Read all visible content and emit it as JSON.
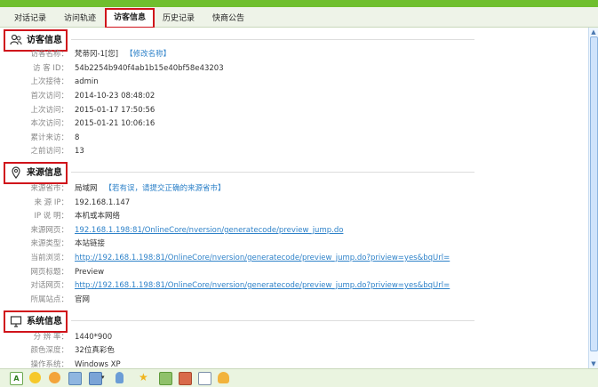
{
  "tabs": [
    {
      "label": "对话记录"
    },
    {
      "label": "访问轨迹"
    },
    {
      "label": "访客信息"
    },
    {
      "label": "历史记录"
    },
    {
      "label": "快商公告"
    }
  ],
  "visitor_info": {
    "title": "访客信息",
    "rows": [
      {
        "label": "访客名称：",
        "value": "梵蒂冈-1[您]",
        "action": "【修改名称】"
      },
      {
        "label": "访 客 ID：",
        "value": "54b2254b940f4ab1b15e40bf58e43203"
      },
      {
        "label": "上次接待：",
        "value": "admin"
      },
      {
        "label": "首次访问：",
        "value": "2014-10-23 08:48:02"
      },
      {
        "label": "上次访问：",
        "value": "2015-01-17 17:50:56"
      },
      {
        "label": "本次访问：",
        "value": "2015-01-21 10:06:16"
      },
      {
        "label": "累计来访：",
        "value": "8"
      },
      {
        "label": "之前访问：",
        "value": "13"
      }
    ]
  },
  "source_info": {
    "title": "来源信息",
    "rows": [
      {
        "label": "来源省市：",
        "value": "局域网",
        "action": "【若有误，请提交正确的来源省市】"
      },
      {
        "label": "来 源 IP：",
        "value": "192.168.1.147"
      },
      {
        "label": "IP 说 明：",
        "value": "本机或本网络"
      },
      {
        "label": "来源网页：",
        "value": "192.168.1.198:81/OnlineCore/nversion/generatecode/preview_jump.do",
        "link": true
      },
      {
        "label": "来源类型：",
        "value": "本站链接"
      },
      {
        "label": "当前浏览：",
        "value": "http://192.168.1.198:81/OnlineCore/nversion/generatecode/preview_jump.do?priview=yes&bqUrl=",
        "link": true
      },
      {
        "label": "网页标题：",
        "value": "Preview"
      },
      {
        "label": "对话网页：",
        "value": "http://192.168.1.198:81/OnlineCore/nversion/generatecode/preview_jump.do?priview=yes&bqUrl=",
        "link": true
      },
      {
        "label": "所属站点：",
        "value": "官网"
      }
    ]
  },
  "system_info": {
    "title": "系统信息",
    "rows": [
      {
        "label": "分 辨 率：",
        "value": "1440*900"
      },
      {
        "label": "颜色深度：",
        "value": "32位真彩色"
      },
      {
        "label": "操作系统：",
        "value": "Windows XP"
      }
    ]
  },
  "toolbar": {
    "icons": [
      "font-icon",
      "emoji-icon",
      "emoji-alt-icon",
      "screenshot-icon",
      "screen-capture-icon",
      "dropdown-icon",
      "microphone-icon",
      "favorite-icon",
      "quick-reply-icon",
      "file-transfer-icon",
      "edit-icon",
      "user-icon"
    ]
  },
  "colors": {
    "accent_green": "#6fbf2e",
    "highlight_red": "#d0131b",
    "link_blue": "#2e82c9"
  }
}
